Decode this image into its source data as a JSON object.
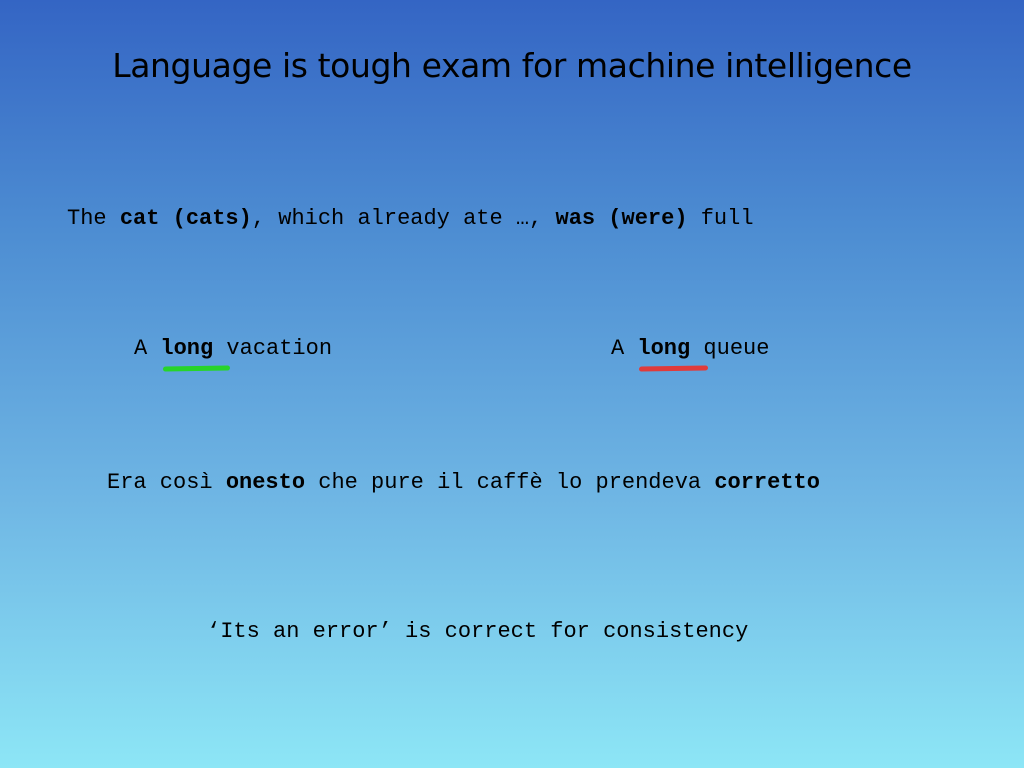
{
  "title": "Language is tough exam for machine intelligence",
  "sentence1": {
    "p1": "The ",
    "b1": "cat (cats)",
    "p2": ", which already ate …, ",
    "b2": "was (were)",
    "p3": " full"
  },
  "sentence2": {
    "p1": "A ",
    "b1": "long",
    "p2": " vacation"
  },
  "sentence3": {
    "p1": "A ",
    "b1": "long",
    "p2": " queue"
  },
  "sentence4": {
    "p1": "Era così ",
    "b1": "onesto",
    "p2": " che pure il caffè lo prendeva ",
    "b2": "corretto"
  },
  "sentence5": {
    "p1": "‘Its an error’ is correct for consistency"
  },
  "colors": {
    "good_underline": "#27d42a",
    "bad_underline": "#e03b3b",
    "background_top": "#3465c4",
    "background_bottom": "#8de6f6"
  }
}
